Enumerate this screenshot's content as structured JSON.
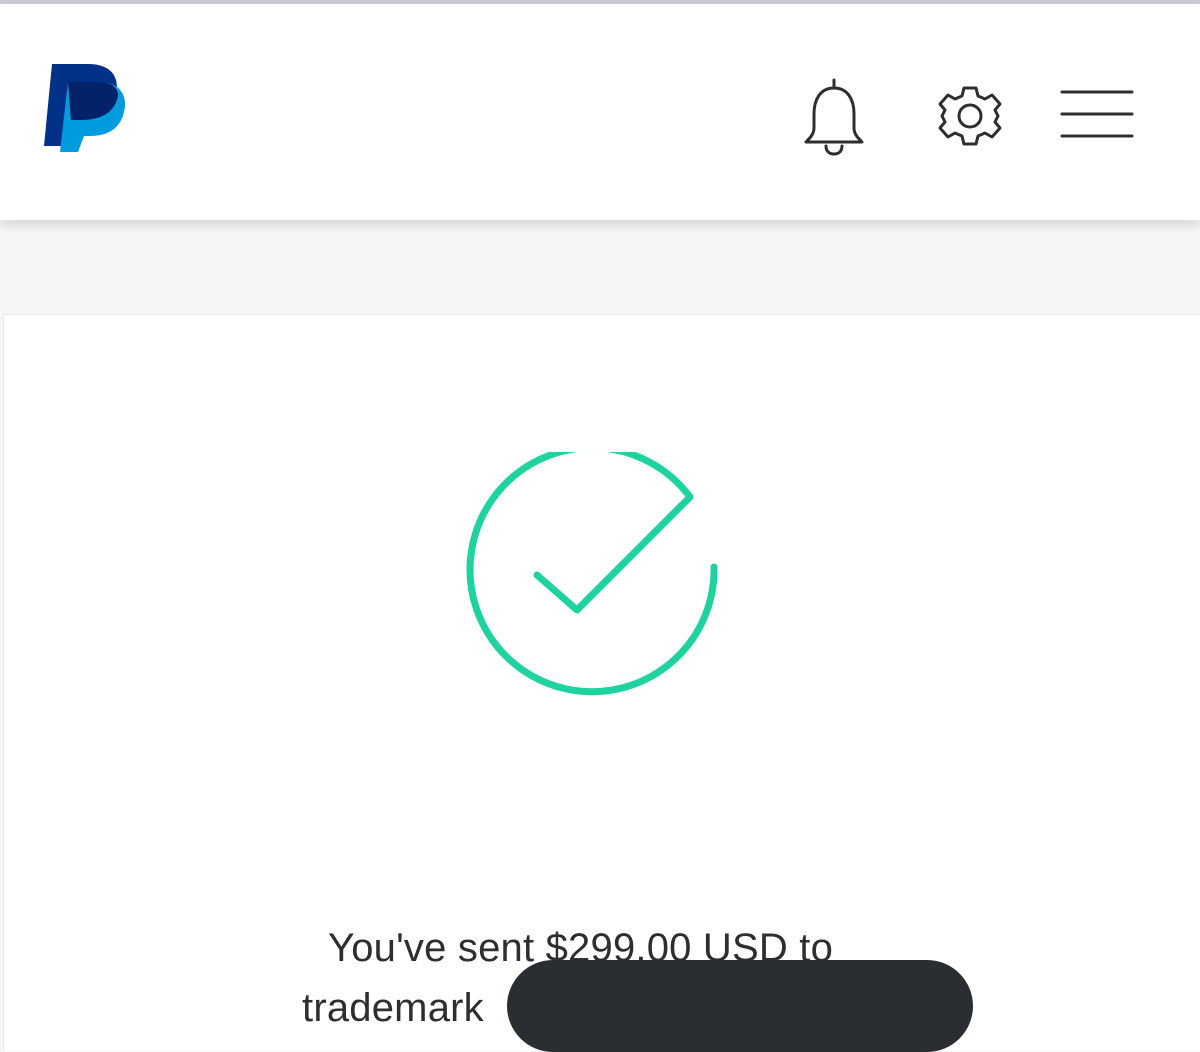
{
  "app": {
    "brand": "PayPal",
    "colors": {
      "brand_dark": "#003087",
      "brand_light": "#009cde",
      "success": "#1ed3a0",
      "text": "#2c2e2f",
      "redaction": "#2a2e32"
    }
  },
  "header": {
    "logo_icon": "paypal-logo",
    "notifications_icon": "bell-icon",
    "settings_icon": "gear-icon",
    "menu_icon": "hamburger-menu-icon"
  },
  "confirmation": {
    "status_icon": "checkmark-circle-icon",
    "message_line1": "You've sent $299.00 USD to",
    "recipient_prefix": "trademark"
  }
}
